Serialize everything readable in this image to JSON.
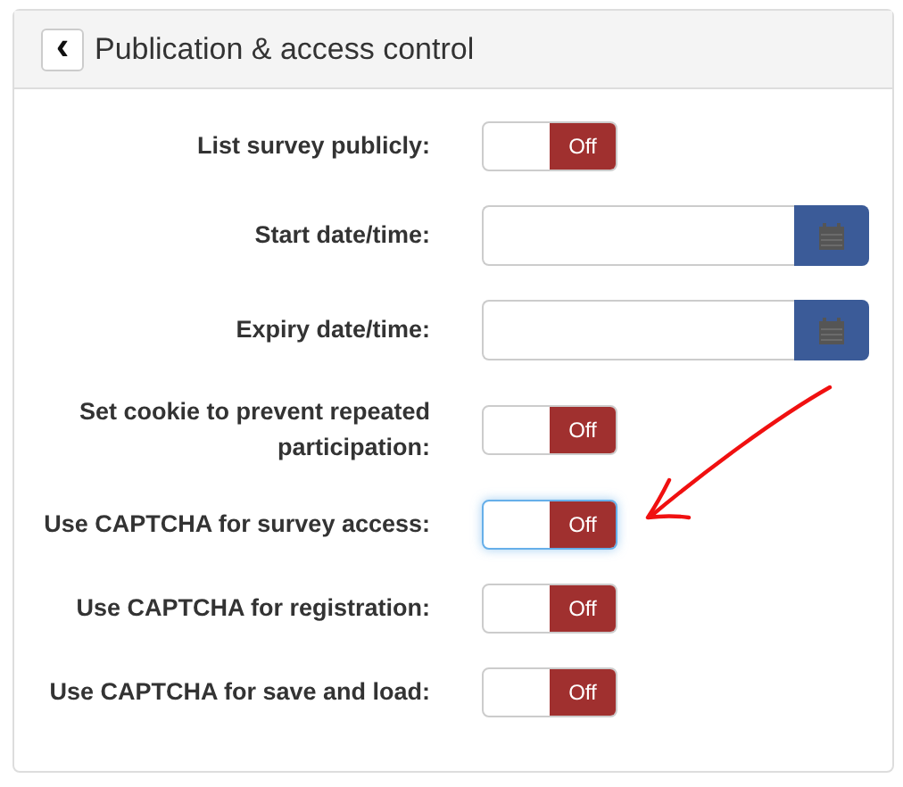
{
  "panel": {
    "title": "Publication & access control",
    "back_icon": "‹"
  },
  "rows": [
    {
      "kind": "toggle",
      "label": "List survey publicly:",
      "value": "Off",
      "on": false,
      "focused": false
    },
    {
      "kind": "date",
      "label": "Start date/time:"
    },
    {
      "kind": "date",
      "label": "Expiry date/time:"
    },
    {
      "kind": "toggle",
      "label": "Set cookie to prevent repeated participation:",
      "value": "Off",
      "on": false,
      "focused": false
    },
    {
      "kind": "toggle",
      "label": "Use CAPTCHA for survey access:",
      "value": "Off",
      "on": false,
      "focused": true
    },
    {
      "kind": "toggle",
      "label": "Use CAPTCHA for registration:",
      "value": "Off",
      "on": false,
      "focused": false
    },
    {
      "kind": "toggle",
      "label": "Use CAPTCHA for save and load:",
      "value": "Off",
      "on": false,
      "focused": false
    }
  ]
}
